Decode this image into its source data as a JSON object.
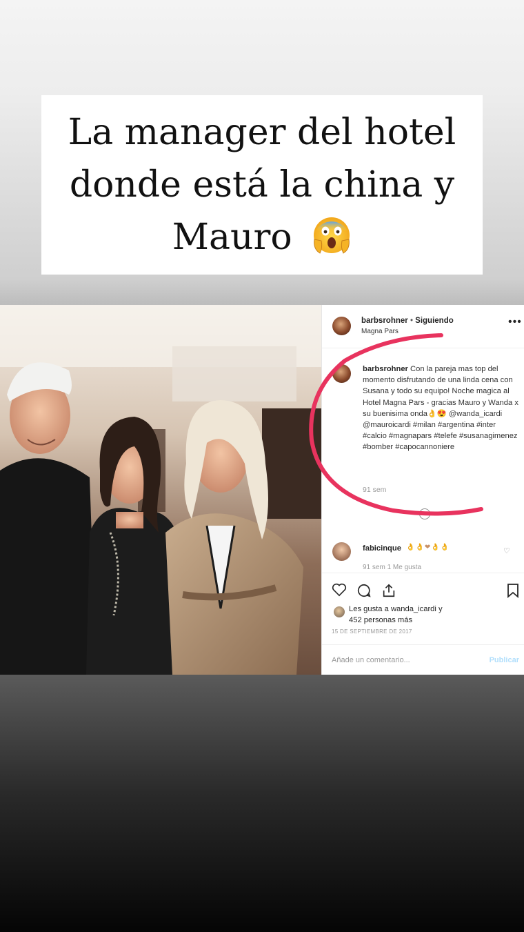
{
  "story": {
    "caption_lines": [
      "La manager del hotel",
      "donde está la china y",
      "Mauro"
    ],
    "emoji": "face-screaming-in-fear"
  },
  "post": {
    "username": "barbsrohner",
    "separator": " • ",
    "follow_status": "Siguiendo",
    "location": "Magna Pars",
    "more_label": "•••",
    "caption_username": "barbsrohner",
    "caption_text": "Con la pareja mas top del momento disfrutando de una linda cena con Susana y todo su equipo! Noche magica al Hotel Magna Pars - gracias Mauro y Wanda x su buenisima onda👌😍 @wanda_icardi @mauroicardi #milan #argentina #inter #calcio #magnapars #telefe #susanagimenez #bomber #capocannoniere",
    "caption_time": "91 sem",
    "comment": {
      "username": "fabicinque",
      "text": "👌👌❤👌👌",
      "meta": "91 sem    1 Me gusta"
    },
    "likes_line1": "Les gusta a wanda_icardi y",
    "likes_line2": "452 personas más",
    "date": "15 DE SEPTIEMBRE DE 2017",
    "comment_placeholder": "Añade un comentario...",
    "publish_label": "Publicar"
  },
  "colors": {
    "annotation_red": "#e8335e",
    "link_blue": "#003569",
    "publish_disabled": "#b2dffc"
  }
}
